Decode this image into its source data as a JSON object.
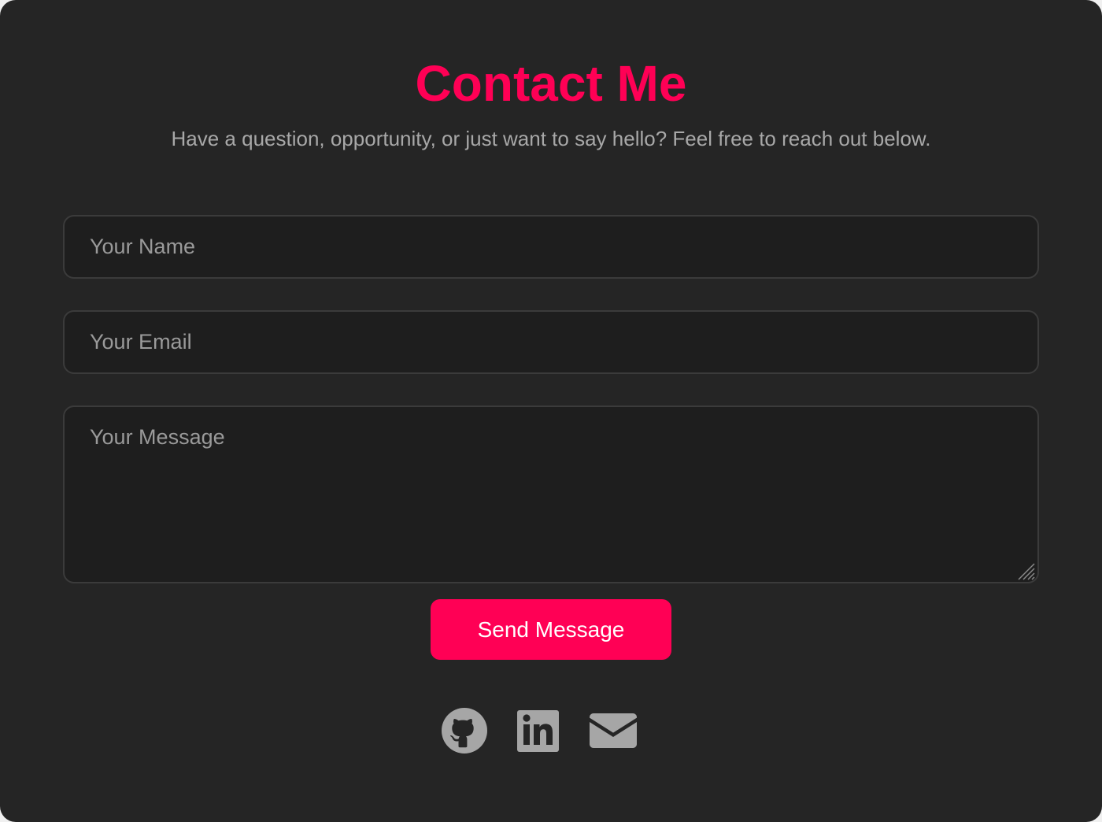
{
  "contact": {
    "title": "Contact Me",
    "subtitle": "Have a question, opportunity, or just want to say hello? Feel free to reach out below."
  },
  "form": {
    "name_placeholder": "Your Name",
    "name_value": "",
    "email_placeholder": "Your Email",
    "email_value": "",
    "message_placeholder": "Your Message",
    "message_value": "",
    "submit_label": "Send Message"
  },
  "social": [
    {
      "icon": "github-icon"
    },
    {
      "icon": "linkedin-icon"
    },
    {
      "icon": "envelope-icon"
    }
  ],
  "colors": {
    "background": "#252525",
    "accent": "#ff0055",
    "muted_text": "#a8a8a8",
    "field_background": "#1e1e1e",
    "field_border": "#3b3b3b",
    "icon": "#a6a6a6"
  }
}
